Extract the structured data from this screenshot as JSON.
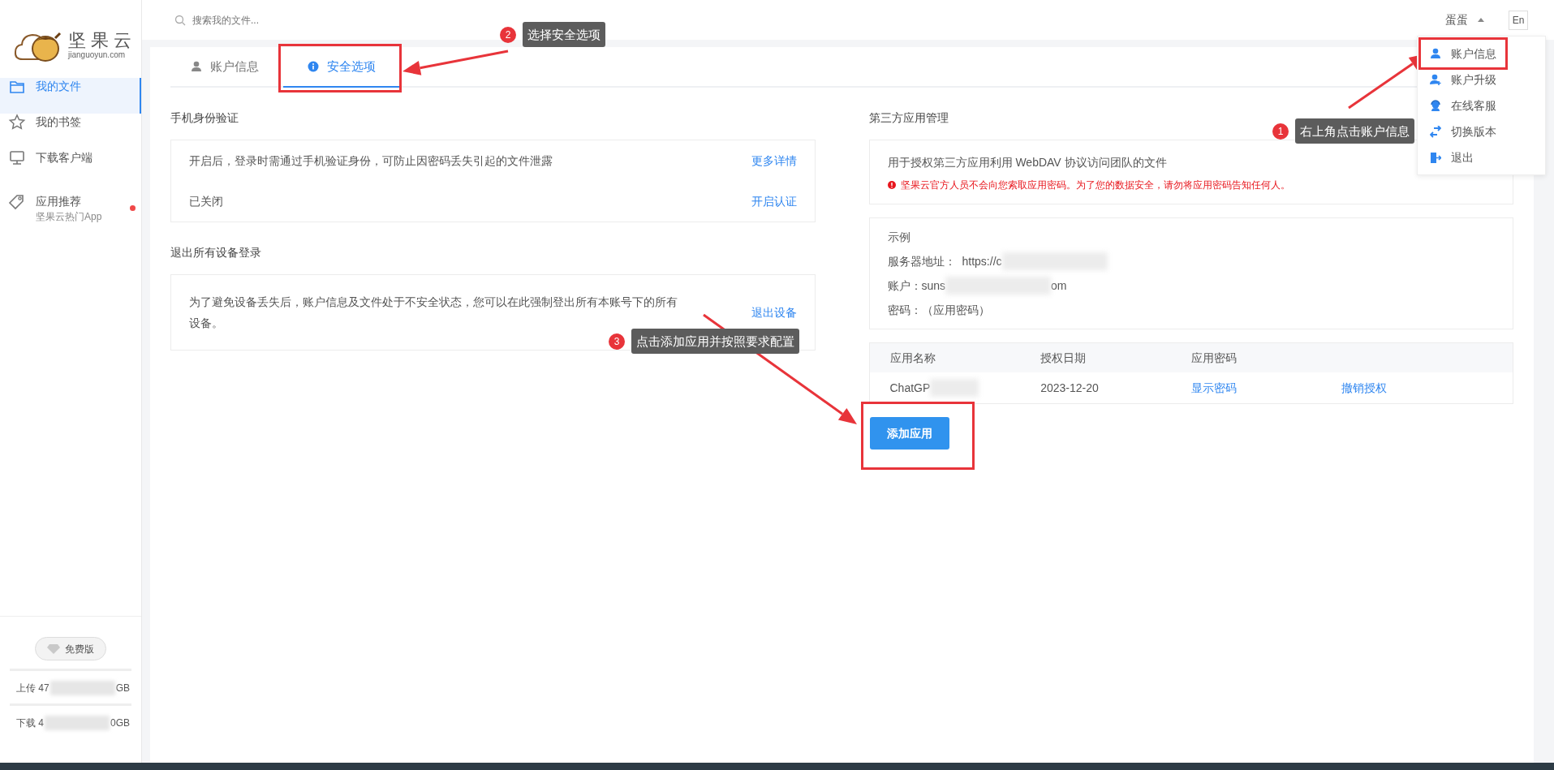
{
  "logo": {
    "name": "坚果云",
    "domain": "jianguoyun.com"
  },
  "sidebar": {
    "items": [
      {
        "label": "我的文件",
        "selected": true
      },
      {
        "label": "我的书签",
        "selected": false
      },
      {
        "label": "下载客户端",
        "selected": false
      },
      {
        "label": "应用推荐",
        "sublabel": "坚果云热门App",
        "selected": false,
        "badge": true
      }
    ],
    "plan": "免费版",
    "upload": {
      "start": "上传 47",
      "end": "GB"
    },
    "download": {
      "start": "下载 4",
      "end": "0GB"
    }
  },
  "search": {
    "placeholder": "搜索我的文件..."
  },
  "user": {
    "name": "蛋蛋",
    "lang": "En"
  },
  "user_menu": [
    {
      "label": "账户信息"
    },
    {
      "label": "账户升级"
    },
    {
      "label": "在线客服"
    },
    {
      "label": "切换版本"
    },
    {
      "label": "退出"
    }
  ],
  "tabs": [
    {
      "label": "账户信息",
      "selected": false
    },
    {
      "label": "安全选项",
      "selected": true
    }
  ],
  "phone_auth": {
    "title": "手机身份验证",
    "description": "开启后，登录时需通过手机验证身份，可防止因密码丢失引起的文件泄露",
    "link": "更多详情",
    "status": "已关闭",
    "action": "开启认证"
  },
  "logout_all": {
    "title": "退出所有设备登录",
    "description": "为了避免设备丢失后，账户信息及文件处于不安全状态，您可以在此强制登出所有本账号下的所有设备。",
    "action": "退出设备"
  },
  "third_party": {
    "title": "第三方应用管理",
    "description": "用于授权第三方应用利用 WebDAV 协议访问团队的文件",
    "warning": "坚果云官方人员不会向您索取应用密码。为了您的数据安全，请勿将应用密码告知任何人。",
    "example": {
      "title": "示例",
      "server_label": "服务器地址：",
      "server_value": "https://c",
      "account_label": "账户：",
      "account_start": "suns",
      "account_end": "om",
      "password_label": "密码：",
      "password_value": "（应用密码）"
    },
    "table": {
      "columns": [
        "应用名称",
        "授权日期",
        "应用密码"
      ],
      "rows": [
        {
          "name": "ChatGP",
          "date": "2023-12-20",
          "show": "显示密码",
          "revoke": "撤销授权"
        }
      ]
    },
    "add_button": "添加应用"
  },
  "callouts": [
    {
      "number": "1",
      "text": "右上角点击账户信息"
    },
    {
      "number": "2",
      "text": "选择安全选项"
    },
    {
      "number": "3",
      "text": "点击添加应用并按照要求配置"
    }
  ]
}
